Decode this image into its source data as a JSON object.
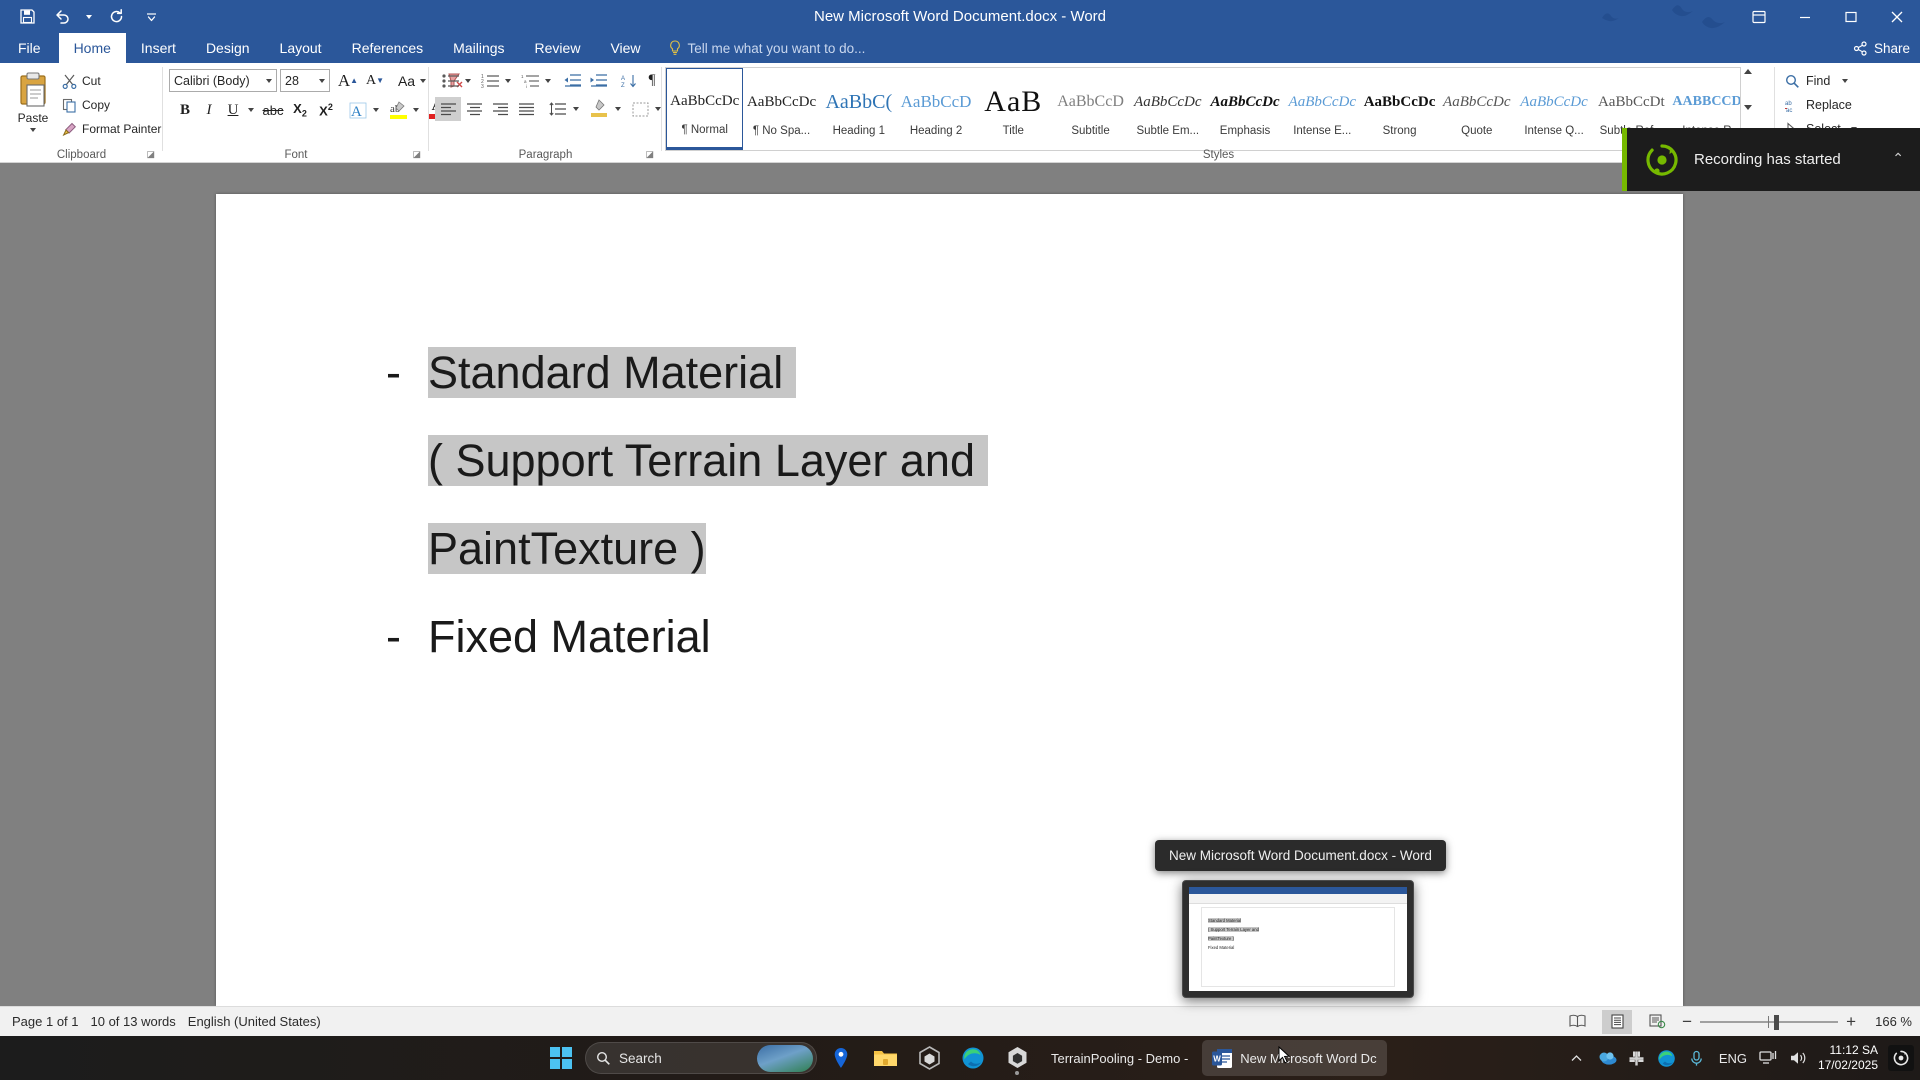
{
  "window": {
    "title": "New Microsoft Word Document.docx - Word",
    "quick_access": [
      "save-icon",
      "undo-icon",
      "redo-icon",
      "customize-qat-icon"
    ],
    "controls": [
      "ribbon-display-options-icon",
      "minimize-icon",
      "maximize-icon",
      "close-icon"
    ]
  },
  "ribbon": {
    "tabs": [
      {
        "label": "File",
        "active": false
      },
      {
        "label": "Home",
        "active": true
      },
      {
        "label": "Insert",
        "active": false
      },
      {
        "label": "Design",
        "active": false
      },
      {
        "label": "Layout",
        "active": false
      },
      {
        "label": "References",
        "active": false
      },
      {
        "label": "Mailings",
        "active": false
      },
      {
        "label": "Review",
        "active": false
      },
      {
        "label": "View",
        "active": false
      }
    ],
    "tell_me": "Tell me what you want to do...",
    "share": "Share",
    "groups": {
      "clipboard": {
        "label": "Clipboard",
        "paste": "Paste",
        "items": [
          "Cut",
          "Copy",
          "Format Painter"
        ]
      },
      "font": {
        "label": "Font",
        "font_name": "Calibri (Body)",
        "font_size": "28",
        "buttons": [
          "grow-font-icon",
          "shrink-font-icon",
          "change-case-icon",
          "clear-formatting-icon",
          "bold-icon",
          "italic-icon",
          "underline-icon",
          "strikethrough-icon",
          "subscript-icon",
          "superscript-icon",
          "text-effects-icon",
          "text-highlight-color-icon",
          "font-color-icon"
        ]
      },
      "paragraph": {
        "label": "Paragraph",
        "buttons": [
          "bullets-icon",
          "numbering-icon",
          "multilevel-list-icon",
          "decrease-indent-icon",
          "increase-indent-icon",
          "sort-icon",
          "show-formatting-marks-icon",
          "align-left-icon",
          "center-icon",
          "align-right-icon",
          "justify-icon",
          "line-spacing-icon",
          "shading-icon",
          "borders-icon"
        ]
      },
      "styles": {
        "label": "Styles",
        "items": [
          {
            "preview": "AaBbCcDc",
            "name": "¶ Normal",
            "style": "normal",
            "selected": true
          },
          {
            "preview": "AaBbCcDc",
            "name": "¶ No Spa...",
            "style": "normal"
          },
          {
            "preview": "AaBbC(",
            "name": "Heading 1",
            "style": "heading1"
          },
          {
            "preview": "AaBbCcD",
            "name": "Heading 2",
            "style": "heading2"
          },
          {
            "preview": "AaB",
            "name": "Title",
            "style": "title"
          },
          {
            "preview": "AaBbCcD",
            "name": "Subtitle",
            "style": "subtitle"
          },
          {
            "preview": "AaBbCcDc",
            "name": "Subtle Em...",
            "style": "subtleem"
          },
          {
            "preview": "AaBbCcDc",
            "name": "Emphasis",
            "style": "emphasis"
          },
          {
            "preview": "AaBbCcDc",
            "name": "Intense E...",
            "style": "intenseem"
          },
          {
            "preview": "AaBbCcDc",
            "name": "Strong",
            "style": "strong"
          },
          {
            "preview": "AaBbCcDc",
            "name": "Quote",
            "style": "quote"
          },
          {
            "preview": "AaBbCcDc",
            "name": "Intense Q...",
            "style": "intenseq"
          },
          {
            "preview": "AaBbCcDt",
            "name": "Subtle Ref...",
            "style": "subtleref"
          },
          {
            "preview": "AABBCCDE",
            "name": "Intense R...",
            "style": "intenseref"
          }
        ]
      },
      "editing": {
        "label": "Editing",
        "items": [
          "Find",
          "Replace",
          "Select"
        ]
      }
    }
  },
  "document": {
    "lines": [
      {
        "bullet": "-",
        "segments": [
          {
            "text": "Standard Material ",
            "highlighted": true
          }
        ]
      },
      {
        "bullet": "",
        "segments": [
          {
            "text": "( Support Terrain Layer and ",
            "highlighted": true
          }
        ]
      },
      {
        "bullet": "",
        "segments": [
          {
            "text": "PaintTexture )",
            "highlighted": true
          }
        ]
      },
      {
        "bullet": "-",
        "segments": [
          {
            "text": "Fixed Material",
            "highlighted": false
          }
        ]
      }
    ]
  },
  "status_bar": {
    "page": "Page 1 of 1",
    "words": "10 of 13 words",
    "language": "English (United States)",
    "views": [
      "read-mode-icon",
      "print-layout-icon",
      "web-layout-icon"
    ],
    "zoom_out": "zoom-out-icon",
    "zoom_in": "zoom-in-icon",
    "zoom_level": "166 %"
  },
  "toast": {
    "text": "Recording has started",
    "icon": "record-circle-icon",
    "accent": "#76b900",
    "collapse": "chevron-up-icon"
  },
  "taskbar_preview": {
    "tooltip": "New Microsoft Word Document.docx - Word",
    "thumb_lines": [
      "Standard Material",
      "( Support Terrain Layer and",
      "PaintTexture )",
      "Fixed Material"
    ]
  },
  "taskbar": {
    "start": "windows-start-icon",
    "search_placeholder": "Search",
    "pinned": [
      "maps-pin-icon",
      "file-explorer-icon",
      "unity-hub-icon",
      "edge-icon"
    ],
    "apps": [
      {
        "label": "TerrainPooling - Demo -",
        "icon": "unity-editor-icon",
        "active": false
      },
      {
        "label": "New Microsoft Word Dc",
        "icon": "word-icon",
        "active": true
      }
    ],
    "tray": {
      "overflow": "chevron-up-icon",
      "icons": [
        "onedrive-icon",
        "slack-icon",
        "edge-icon",
        "microphone-icon"
      ],
      "language": "ENG",
      "network": "network-icon",
      "volume": "volume-icon",
      "time": "11:12 SA",
      "date": "17/02/2025",
      "recording": "record-indicator-icon"
    }
  }
}
